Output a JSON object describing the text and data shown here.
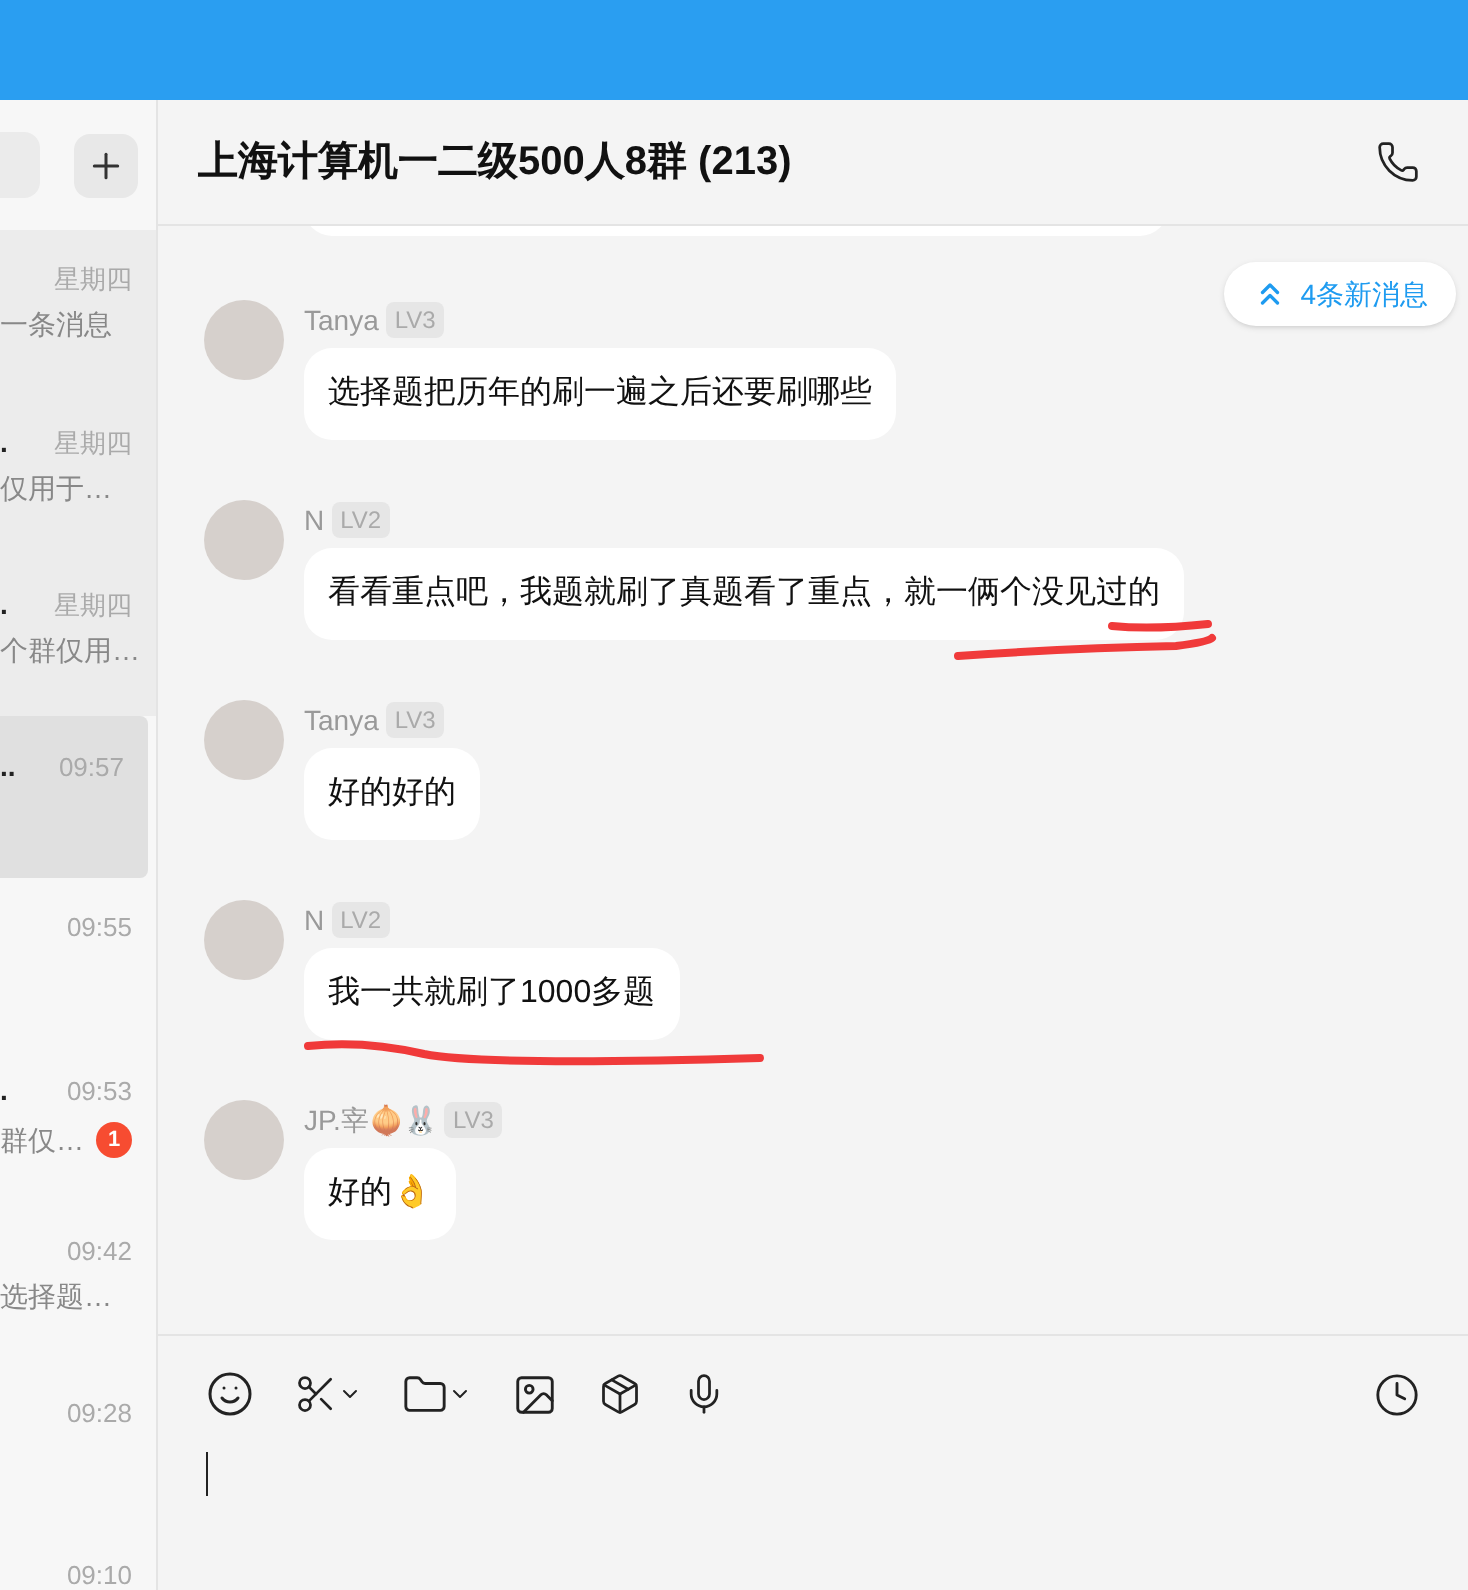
{
  "sidebar": {
    "pinned": [
      {
        "time": "星期四",
        "preview": "一条消息",
        "selected": false
      },
      {
        "title": ".",
        "time": "星期四",
        "preview": "仅用于…",
        "selected": false
      },
      {
        "title": ".",
        "time": "星期四",
        "preview": "个群仅用…",
        "selected": false
      }
    ],
    "items": [
      {
        "title": "..",
        "time": "09:57",
        "selected": true
      },
      {
        "time": "09:55",
        "selected": false
      },
      {
        "title": ".",
        "time": "09:53",
        "preview": "群仅…",
        "badge": "1",
        "selected": false
      },
      {
        "time": "09:42",
        "preview": "选择题…",
        "selected": false
      },
      {
        "time": "09:28",
        "selected": false
      },
      {
        "time": "09:10",
        "selected": false
      }
    ]
  },
  "chat": {
    "title": "上海计算机一二级500人8群 (213)",
    "new_messages": "4条新消息",
    "messages": [
      {
        "sender": "Tanya",
        "level": "LV3",
        "text": "选择题把历年的刷一遍之后还要刷哪些",
        "kind": "plain"
      },
      {
        "sender": "N",
        "level": "LV2",
        "text": "看看重点吧，我题就刷了真题看了重点，就一俩个没见过的",
        "kind": "double_underline"
      },
      {
        "sender": "Tanya",
        "level": "LV3",
        "text": "好的好的",
        "kind": "plain"
      },
      {
        "sender": "N",
        "level": "LV2",
        "text": "我一共就刷了1000多题",
        "kind": "single_underline"
      },
      {
        "sender": "JP.宰🧅🐰",
        "level": "LV3",
        "text": "好的👌",
        "kind": "plain"
      }
    ]
  }
}
